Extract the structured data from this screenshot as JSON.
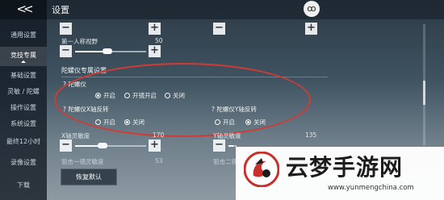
{
  "header": {
    "title": "设置",
    "back_icon": "double-chevron-left-icon",
    "emblem": "ꝏ"
  },
  "sidebar": {
    "items": [
      {
        "label": "通用设置"
      },
      {
        "label": "竞技专属",
        "active": true
      },
      {
        "label": "基础设置"
      },
      {
        "label": "灵敏 / 陀螺"
      },
      {
        "label": "操作设置"
      },
      {
        "label": "系统设置"
      },
      {
        "label": "最终12小时"
      },
      {
        "label": "录像设置"
      },
      {
        "label": "下载"
      }
    ]
  },
  "settings": {
    "first_person_fov": {
      "label": "第一人称视野",
      "value": "50"
    },
    "gyro_section_title": "陀螺仪专属设置",
    "gyro": {
      "label": "陀螺仪",
      "options": [
        "开启",
        "开镜开启",
        "关闭"
      ],
      "selected": "开启"
    },
    "gyro_x_invert": {
      "label": "陀螺仪X轴反转",
      "options": [
        "开启",
        "关闭"
      ],
      "selected": "关闭"
    },
    "gyro_y_invert": {
      "label": "陀螺仪Y轴反转",
      "options": [
        "开启",
        "关闭"
      ],
      "selected": "关闭"
    },
    "x_sensitivity": {
      "label": "X轴灵敏度",
      "value": "170"
    },
    "y_sensitivity": {
      "label": "Y轴灵敏度",
      "value": "135"
    },
    "scope_x": {
      "label": "狙击一镜灵敏度",
      "value": "53"
    },
    "scope_y": {
      "label": "狙击二镜灵敏度"
    },
    "reset_button": "恢复默认"
  },
  "watermark": {
    "title": "云梦手游网",
    "url": "www.yunmengchina.com"
  },
  "colors": {
    "highlight_ellipse": "#d43a34",
    "brand_red": "#c8312b"
  }
}
